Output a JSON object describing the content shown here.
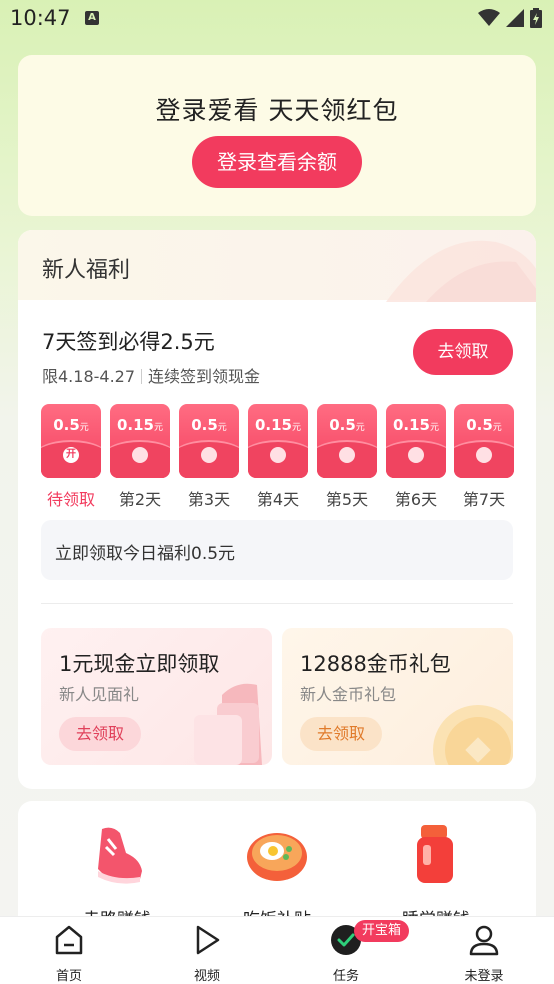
{
  "status_bar": {
    "time": "10:47",
    "notification": "A"
  },
  "login": {
    "title": "登录爱看 天天领红包",
    "button": "登录查看余额"
  },
  "welfare": {
    "title": "新人福利",
    "checkin": {
      "title": "7天签到必得2.5元",
      "date_range": "限4.18-4.27",
      "desc": "连续签到领现金",
      "claim": "去领取",
      "days": [
        {
          "amount": "0.5",
          "unit": "元",
          "label": "待领取",
          "seal": "开",
          "active": true
        },
        {
          "amount": "0.15",
          "unit": "元",
          "label": "第2天"
        },
        {
          "amount": "0.5",
          "unit": "元",
          "label": "第3天"
        },
        {
          "amount": "0.15",
          "unit": "元",
          "label": "第4天"
        },
        {
          "amount": "0.5",
          "unit": "元",
          "label": "第5天"
        },
        {
          "amount": "0.15",
          "unit": "元",
          "label": "第6天"
        },
        {
          "amount": "0.5",
          "unit": "元",
          "label": "第7天"
        }
      ]
    },
    "today_text": "立即领取今日福利0.5元",
    "gifts": [
      {
        "title": "1元现金立即领取",
        "subtitle": "新人见面礼",
        "button": "去领取"
      },
      {
        "title": "12888金币礼包",
        "subtitle": "新人金币礼包",
        "button": "去领取"
      }
    ]
  },
  "activities": [
    {
      "label": "走路赚钱",
      "icon": "sneaker-icon"
    },
    {
      "label": "吃饭补贴",
      "icon": "meal-bowl-icon"
    },
    {
      "label": "睡觉赚钱",
      "icon": "thermos-icon"
    }
  ],
  "nav": {
    "items": [
      {
        "label": "首页",
        "icon": "home-icon"
      },
      {
        "label": "视频",
        "icon": "play-icon"
      },
      {
        "label": "任务",
        "icon": "task-check-icon"
      },
      {
        "label": "未登录",
        "icon": "user-icon"
      }
    ],
    "badge": "开宝箱"
  },
  "colors": {
    "accent": "#f23b5e",
    "background_top": "#d9f1b5"
  }
}
